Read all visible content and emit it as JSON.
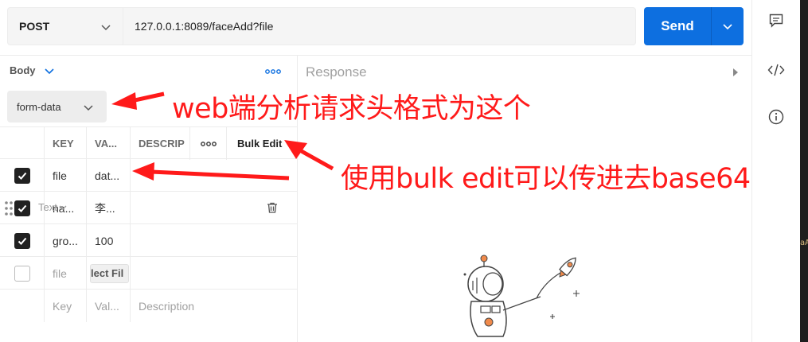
{
  "request": {
    "method": "POST",
    "url": "127.0.0.1:8089/faceAdd?file",
    "send_label": "Send"
  },
  "body": {
    "tab_label": "Body",
    "mode": "form-data",
    "columns": {
      "key": "KEY",
      "value": "VA...",
      "description": "DESCRIP",
      "bulk_edit": "Bulk Edit"
    },
    "rows": [
      {
        "checked": true,
        "key": "file",
        "value": "dat...",
        "description": ""
      },
      {
        "checked": true,
        "key": "na...",
        "value": "李...",
        "description": "",
        "type_label": "Text"
      },
      {
        "checked": true,
        "key": "gro...",
        "value": "100",
        "description": ""
      },
      {
        "checked": false,
        "key": "file",
        "value": "lect Fil",
        "description": ""
      }
    ],
    "placeholder_row": {
      "key": "Key",
      "value": "Val...",
      "description": "Description"
    }
  },
  "response": {
    "label": "Response"
  },
  "annotations": {
    "form_data_note": "web端分析请求头格式为这个",
    "bulk_edit_note": "使用bulk edit可以传进去base64"
  },
  "side_text": "aA",
  "icons": {
    "method_chevron": "chevron-down-icon",
    "send_dropdown": "chevron-down-icon",
    "comments": "comment-icon",
    "code": "code-icon",
    "info": "info-icon",
    "more": "more-horizontal-icon",
    "trash": "trash-icon",
    "drag": "drag-handle-icon"
  },
  "colors": {
    "send_button": "#0d6fe0",
    "annotation": "#ff1a1a",
    "checkbox": "#212121"
  }
}
